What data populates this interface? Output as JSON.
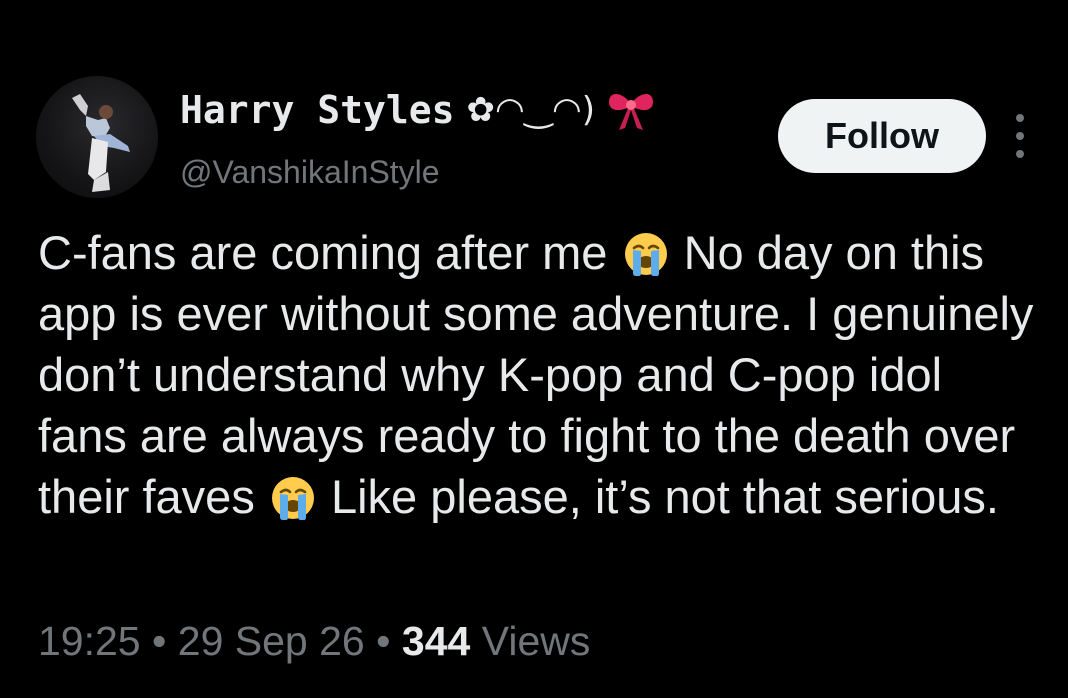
{
  "author": {
    "display_name": "Harry Styles",
    "display_name_decoration": "✿◠‿◠)",
    "bow_icon": "ribbon-bow-icon",
    "handle": "@VanshikaInStyle"
  },
  "follow_button": {
    "label": "Follow"
  },
  "more_menu": {
    "icon": "more-vertical-icon"
  },
  "tweet": {
    "segments": [
      "C-fans are coming after me",
      "No day on this app is ever without some adventure. I genuinely don’t understand why K-pop and C-pop idol fans are always ready to fight to the death over their faves",
      "Like please, it’s not that serious."
    ],
    "emoji": "loudly-crying-face-icon"
  },
  "meta": {
    "time": "19:25",
    "date": "29 Sep 26",
    "separator": "•",
    "views_count": "344",
    "views_label": "Views"
  },
  "colors": {
    "background": "#000000",
    "primary_text": "#e7e9ea",
    "secondary_text": "#71767b",
    "follow_bg": "#eff3f4",
    "follow_text": "#0f1419",
    "bow": "#e0245e"
  }
}
